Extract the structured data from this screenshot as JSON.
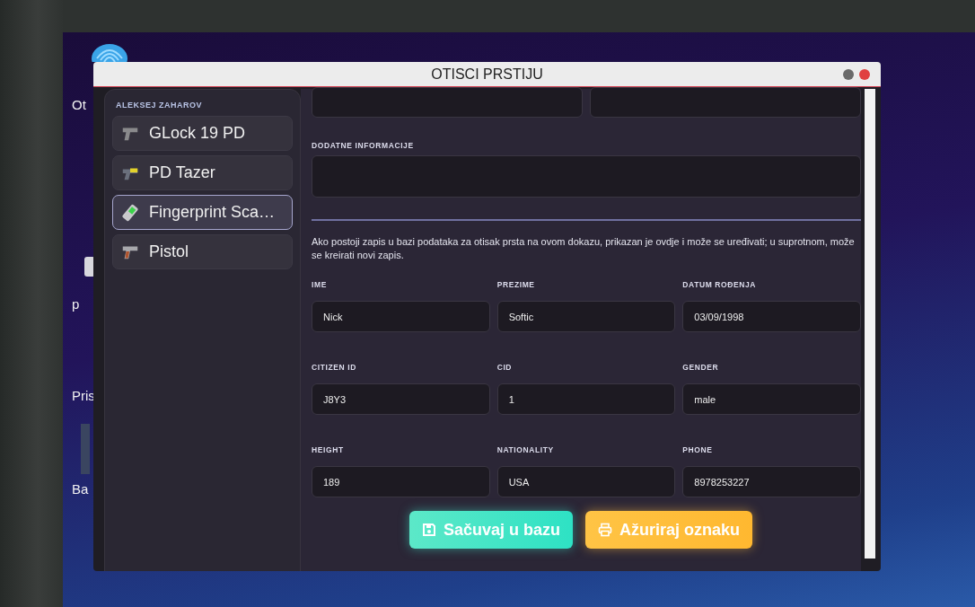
{
  "desktop_icons": [
    {
      "label": "Ot",
      "kind": "fingerprint"
    },
    {
      "label": "p",
      "kind": "disk"
    },
    {
      "label": "Pris",
      "kind": "none"
    },
    {
      "label": "Ba",
      "kind": "bar"
    }
  ],
  "window": {
    "title": "OTISCI PRSTIJU"
  },
  "sidebar": {
    "owner": "ALEKSEJ ZAHAROV",
    "items": [
      {
        "label": "GLock 19 PD",
        "kind": "pistol",
        "selected": false
      },
      {
        "label": "PD Tazer",
        "kind": "taser",
        "selected": false
      },
      {
        "label": "Fingerprint Sca…",
        "kind": "scanner",
        "selected": true
      },
      {
        "label": "Pistol",
        "kind": "pistol2",
        "selected": false
      }
    ]
  },
  "form": {
    "top_fields": [
      {
        "kind": "input"
      },
      {
        "kind": "input"
      }
    ],
    "notes": {
      "label": "DODATNE INFORMACIJE"
    },
    "info": "Ako postoji zapis u bazi podataka za otisak prsta na ovom dokazu, prikazan je ovdje i može se uređivati; u suprotnom, može se kreirati novi zapis.",
    "fields": [
      {
        "label": "IME",
        "value": "Nick"
      },
      {
        "label": "PREZIME",
        "value": "Softic"
      },
      {
        "label": "DATUM ROĐENJA",
        "value": "03/09/1998"
      },
      {
        "label": "CITIZEN ID",
        "value": "J8Y3"
      },
      {
        "label": "CID",
        "value": "1"
      },
      {
        "label": "GENDER",
        "value": "male"
      },
      {
        "label": "HEIGHT",
        "value": "189"
      },
      {
        "label": "NATIONALITY",
        "value": "USA"
      },
      {
        "label": "PHONE",
        "value": "8978253227"
      }
    ]
  },
  "buttons": [
    {
      "label": "Sačuvaj u bazu",
      "kind": "save"
    },
    {
      "label": "Ažuriraj oznaku",
      "kind": "print"
    }
  ]
}
